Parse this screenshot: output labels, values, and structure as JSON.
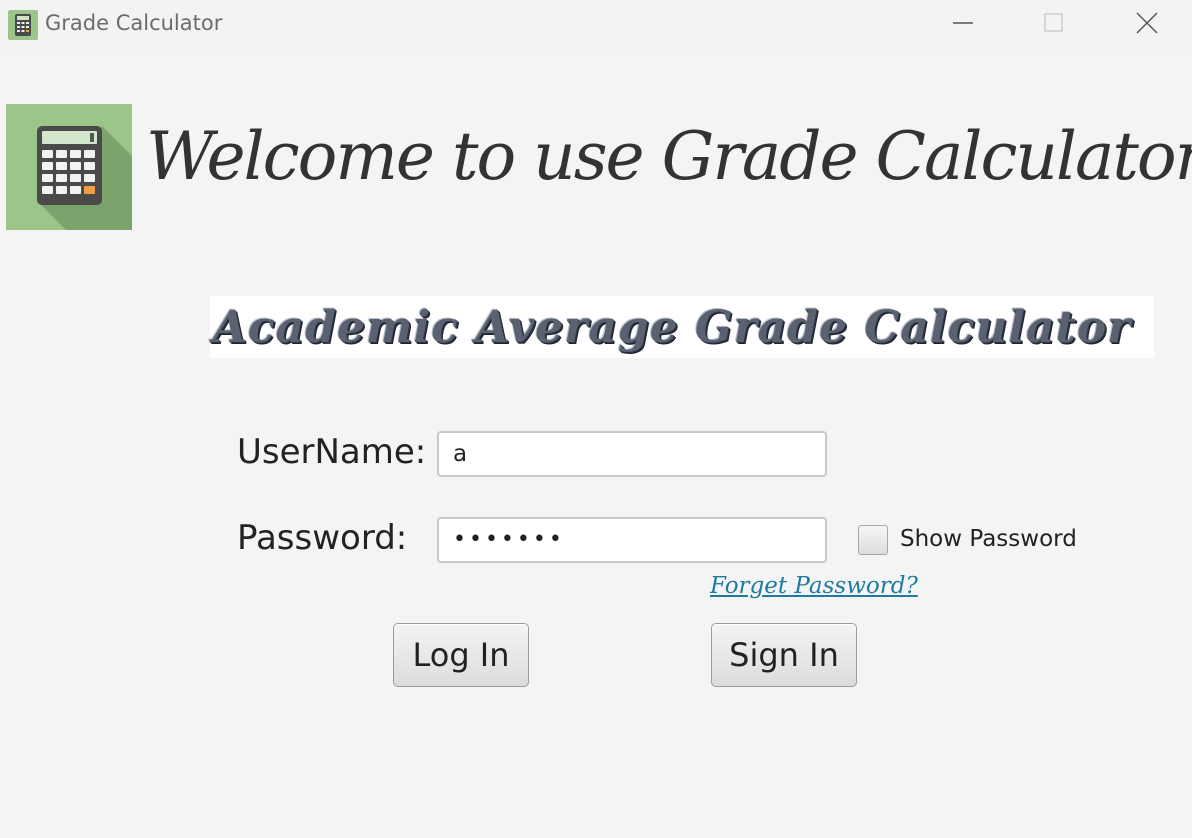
{
  "window": {
    "title": "Grade Calculator",
    "icon": "calculator-icon"
  },
  "header": {
    "welcome_text": "Welcome to use Grade Calculator",
    "logo_icon": "calculator-icon"
  },
  "banner": {
    "text": "Academic Average Grade Calculator"
  },
  "form": {
    "username_label": "UserName:",
    "username_value": "a",
    "password_label": "Password:",
    "password_value": "•••••••",
    "show_password_label": "Show Password",
    "show_password_checked": false,
    "forgot_password_label": "Forget Password?",
    "login_button": "Log In",
    "signin_button": "Sign In"
  },
  "colors": {
    "background": "#f4f4f4",
    "logo_green": "#9cc58a",
    "link": "#1f7aa0"
  }
}
